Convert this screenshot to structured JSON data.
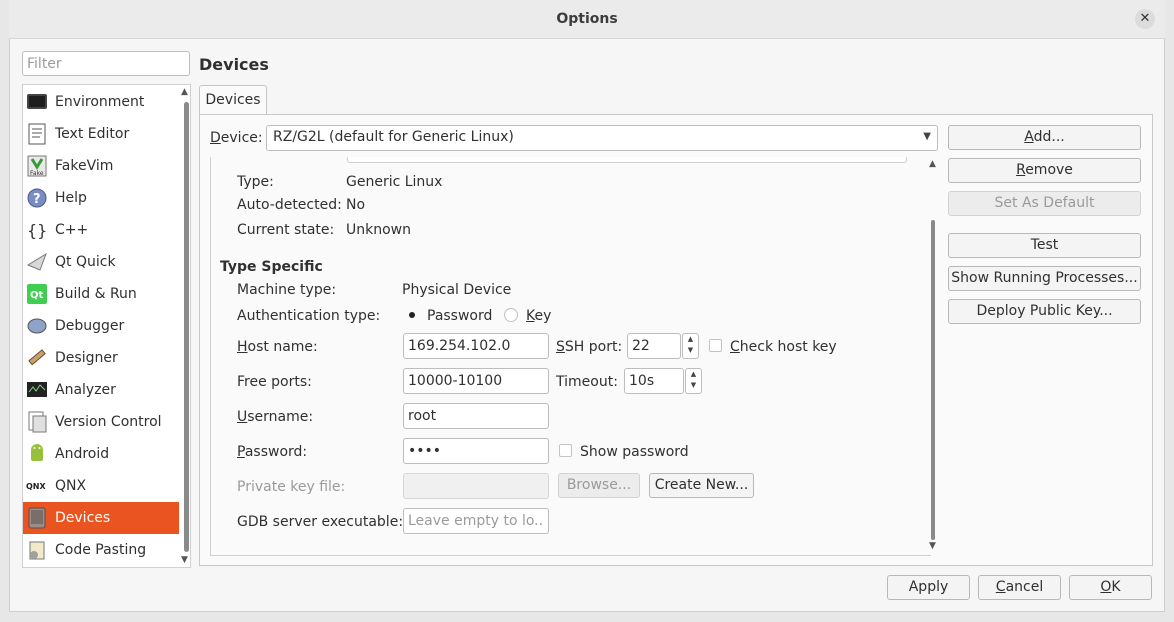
{
  "window": {
    "title": "Options",
    "close_glyph": "✕"
  },
  "filter": {
    "placeholder": "Filter"
  },
  "categories": [
    {
      "label": "Environment",
      "icon": "monitor-icon"
    },
    {
      "label": "Text Editor",
      "icon": "text-editor-icon"
    },
    {
      "label": "FakeVim",
      "icon": "fakevim-icon"
    },
    {
      "label": "Help",
      "icon": "help-icon"
    },
    {
      "label": "C++",
      "icon": "cpp-icon"
    },
    {
      "label": "Qt Quick",
      "icon": "qt-quick-icon"
    },
    {
      "label": "Build & Run",
      "icon": "build-run-icon"
    },
    {
      "label": "Debugger",
      "icon": "debugger-icon"
    },
    {
      "label": "Designer",
      "icon": "designer-icon"
    },
    {
      "label": "Analyzer",
      "icon": "analyzer-icon"
    },
    {
      "label": "Version Control",
      "icon": "version-control-icon"
    },
    {
      "label": "Android",
      "icon": "android-icon"
    },
    {
      "label": "QNX",
      "icon": "qnx-icon"
    },
    {
      "label": "Devices",
      "icon": "devices-icon",
      "selected": true
    },
    {
      "label": "Code Pasting",
      "icon": "code-pasting-icon"
    }
  ],
  "page": {
    "heading": "Devices",
    "tab": "Devices"
  },
  "device": {
    "label_prefix": "D",
    "label_rest": "evice:",
    "selected": "RZ/G2L (default for Generic Linux)"
  },
  "general": {
    "type_label": "Type:",
    "type_value": "Generic Linux",
    "auto_label": "Auto-detected:",
    "auto_value": "No",
    "state_label": "Current state:",
    "state_value": "Unknown"
  },
  "type_specific": {
    "title": "Type Specific",
    "machine_type_label": "Machine type:",
    "machine_type_value": "Physical Device",
    "auth_label": "Authentication type:",
    "auth_password": "Password",
    "auth_key_u": "K",
    "auth_key_rest": "ey",
    "host_label_u": "H",
    "host_label_rest": "ost name:",
    "host_value": "169.254.102.0",
    "ssh_label_u": "S",
    "ssh_label_rest": "SH port:",
    "ssh_value": "22",
    "check_host_u": "C",
    "check_host_rest": "heck host key",
    "free_ports_label": "Free ports:",
    "free_ports_value": "10000-10100",
    "timeout_label": "Timeout:",
    "timeout_value": "10s",
    "username_label_u": "U",
    "username_label_rest": "sername:",
    "username_value": "root",
    "password_label_u": "P",
    "password_label_rest": "assword:",
    "password_value": "••••",
    "show_password": "Show password",
    "private_key_label": "Private key file:",
    "browse": "Browse...",
    "create_new": "Create New...",
    "gdb_label": "GDB server executable:",
    "gdb_placeholder": "Leave empty to lo..."
  },
  "actions": {
    "add_u": "A",
    "add_rest": "dd...",
    "remove_u": "R",
    "remove_rest": "emove",
    "set_default": "Set As Default",
    "test": "Test",
    "show_processes": "Show Running Processes...",
    "deploy_key": "Deploy Public Key..."
  },
  "footer": {
    "apply": "Apply",
    "cancel_u": "C",
    "cancel_rest": "ancel",
    "ok_u": "O",
    "ok_rest": "K"
  },
  "colors": {
    "accent": "#e95420"
  }
}
